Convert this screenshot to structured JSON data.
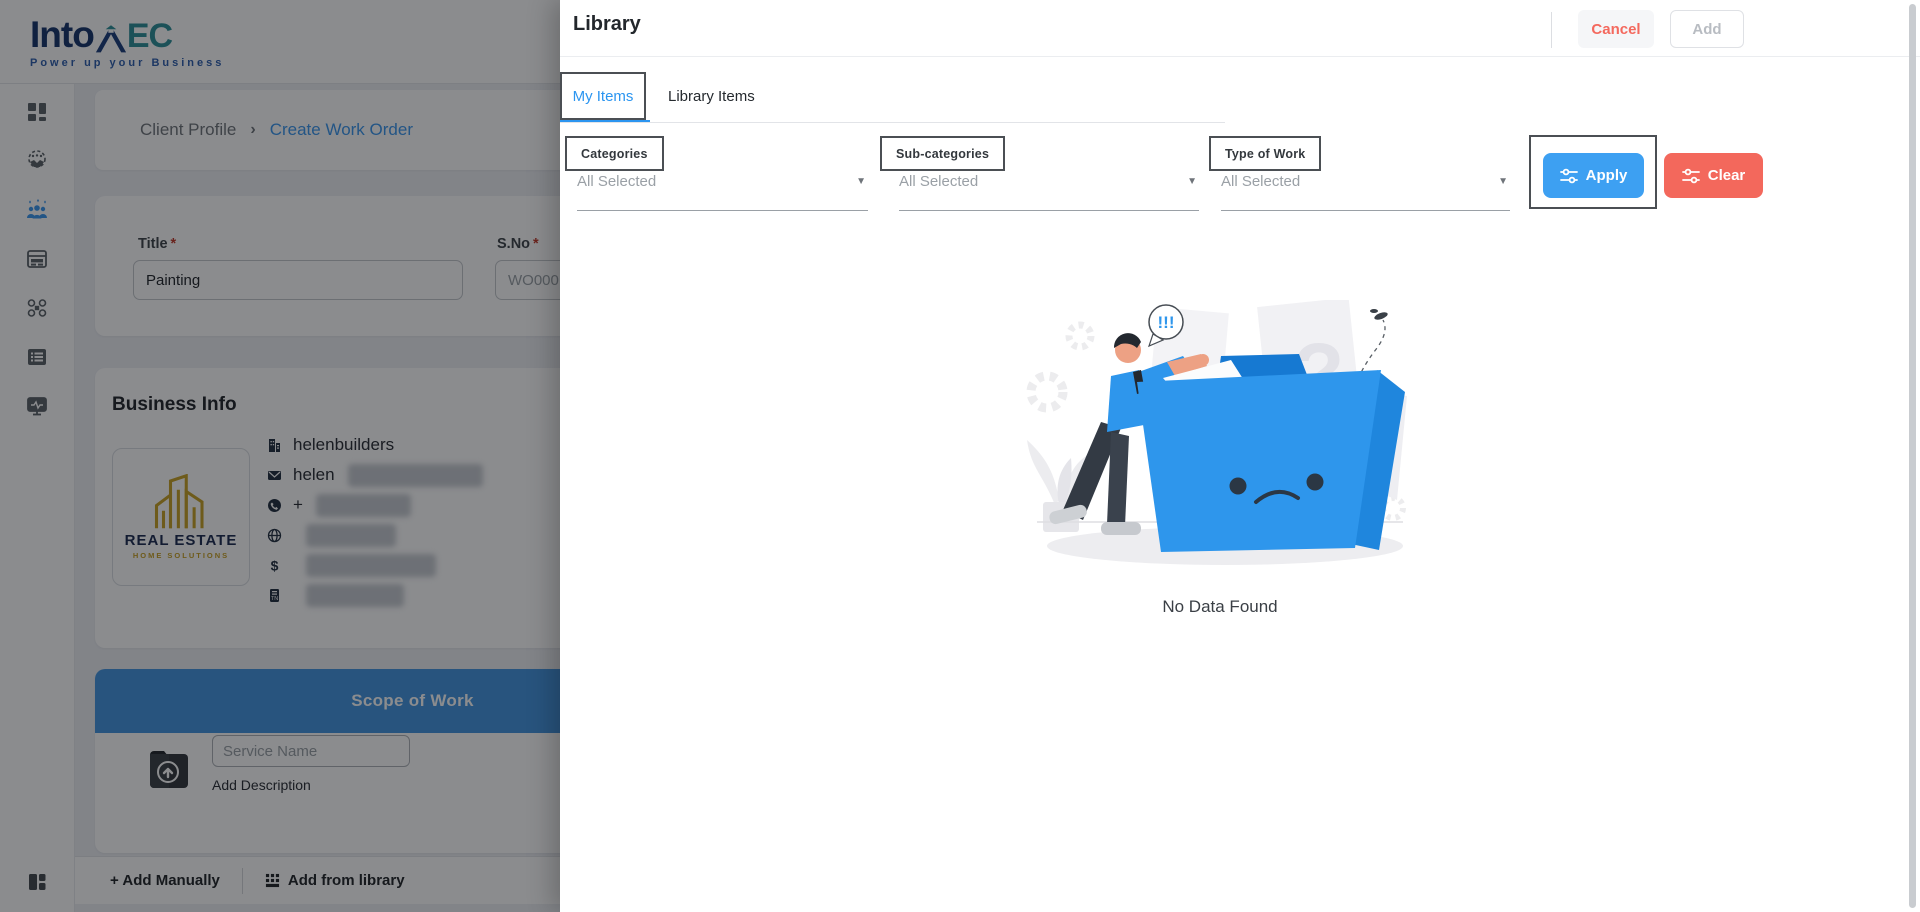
{
  "header": {
    "logo_primary": "Into",
    "logo_accent": "EC",
    "tagline": "Power up your Business"
  },
  "sidebar": {
    "icons": [
      {
        "name": "dashboard-icon"
      },
      {
        "name": "handshake-icon"
      },
      {
        "name": "clients-icon",
        "active": true
      },
      {
        "name": "browser-card-icon"
      },
      {
        "name": "team-network-icon"
      },
      {
        "name": "list-report-icon"
      },
      {
        "name": "monitor-pulse-icon"
      },
      {
        "name": "collapse-sidebar-icon"
      }
    ]
  },
  "breadcrumb": {
    "parent": "Client Profile",
    "separator": "›",
    "current": "Create Work Order"
  },
  "work_order_form": {
    "title_label": "Title",
    "required_mark": "*",
    "title_value": "Painting",
    "sno_label": "S.No",
    "sno_value": "WO000"
  },
  "business_info": {
    "heading": "Business Info",
    "logo_card": {
      "line1": "REAL ESTATE",
      "line2": "HOME SOLUTIONS"
    },
    "rows": [
      {
        "icon": "building-icon",
        "text": "helenbuilders"
      },
      {
        "icon": "envelope-icon",
        "text": "helen"
      },
      {
        "icon": "phone-icon",
        "text": "+"
      },
      {
        "icon": "globe-icon",
        "text": ""
      },
      {
        "icon": "currency-icon",
        "text": ""
      },
      {
        "icon": "tax-document-icon",
        "text": ""
      }
    ]
  },
  "scope_of_work": {
    "header": "Scope of Work",
    "service_name_placeholder": "Service Name",
    "add_description_label": "Add Description"
  },
  "footer_actions": {
    "add_manually_label": "+ Add Manually",
    "add_from_library_label": "Add from library"
  },
  "library_panel": {
    "title": "Library",
    "cancel_label": "Cancel",
    "add_label": "Add",
    "caret_icon": "▼",
    "tabs": [
      {
        "label": "My Items",
        "active": true
      },
      {
        "label": "Library Items",
        "active": false
      }
    ],
    "filters": [
      {
        "label": "Categories",
        "value": "All Selected"
      },
      {
        "label": "Sub-categories",
        "value": "All Selected"
      },
      {
        "label": "Type of Work",
        "value": "All Selected"
      }
    ],
    "apply_label": "Apply",
    "clear_label": "Clear",
    "empty_state": {
      "message": "No Data Found",
      "illustration": "sad-empty-folder-illustration"
    }
  },
  "colors": {
    "primary_blue": "#2e96ec",
    "tab_blue": "#2b95f0",
    "apply_blue": "#3da0f2",
    "clear_red": "#f3685c",
    "cancel_red": "#f4695e",
    "scope_header_blue": "#4596e0",
    "logo_navy": "#17356d",
    "logo_teal": "#2e9099",
    "gold": "#c9a227"
  }
}
